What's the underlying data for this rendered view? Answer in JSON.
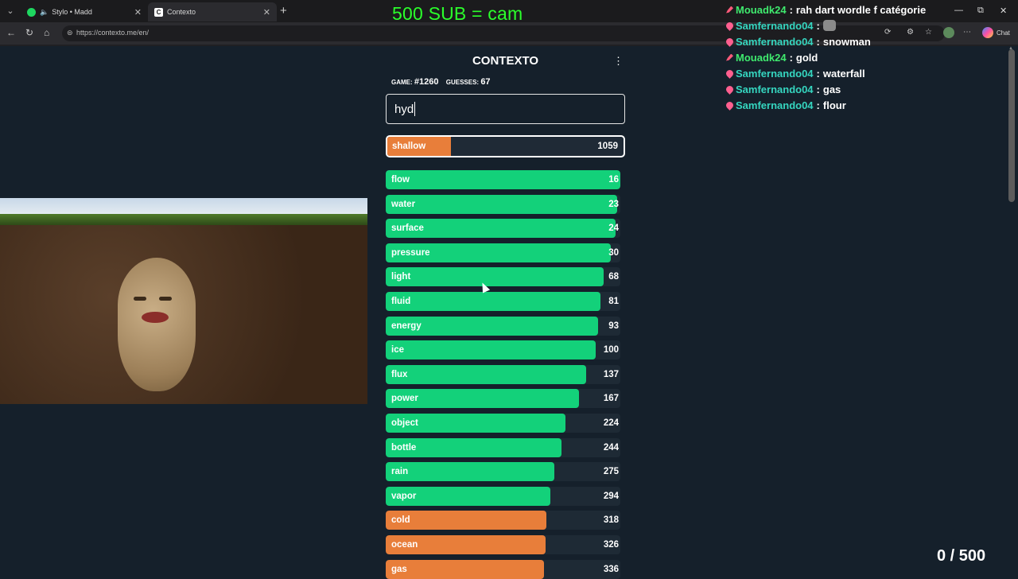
{
  "browser": {
    "tabs": [
      {
        "label": "Stylo • Madd",
        "favicon": "spotify-icon"
      },
      {
        "label": "Contexto",
        "favicon": "contexto-favicon"
      }
    ],
    "favicon_letter": "C",
    "url": "https://contexto.me/en/",
    "chat_button": "Chat"
  },
  "overlay": {
    "title": "500 SUB = cam",
    "sub_counter": "0 / 500"
  },
  "chat": [
    {
      "badge": "pencil",
      "user": "Mouadk24",
      "user_color": "#3fea6e",
      "message": "rah dart wordle f catégorie"
    },
    {
      "badge": "heart",
      "user": "Samfernando04",
      "user_color": "#35d6c0",
      "message": "",
      "emote": "cat-emote"
    },
    {
      "badge": "heart",
      "user": "Samfernando04",
      "user_color": "#35d6c0",
      "message": "snowman"
    },
    {
      "badge": "pencil",
      "user": "Mouadk24",
      "user_color": "#3fea6e",
      "message": "gold"
    },
    {
      "badge": "heart",
      "user": "Samfernando04",
      "user_color": "#35d6c0",
      "message": "waterfall"
    },
    {
      "badge": "heart",
      "user": "Samfernando04",
      "user_color": "#35d6c0",
      "message": "gas"
    },
    {
      "badge": "heart",
      "user": "Samfernando04",
      "user_color": "#35d6c0",
      "message": "flour"
    }
  ],
  "game": {
    "title": "CONTEXTO",
    "game_label": "Game:",
    "game_number": "#1260",
    "guesses_label": "Guesses:",
    "guesses_count": "67",
    "input_value": "hyd",
    "last_guess": {
      "word": "shallow",
      "rank": 1059,
      "fill": 0.27,
      "color": "#e87e3a"
    },
    "colors": {
      "green": "#13d17a",
      "orange": "#e87e3a",
      "red": "#f02d5a"
    },
    "guesses": [
      {
        "word": "flow",
        "rank": 16,
        "fill": 1.0,
        "color": "green"
      },
      {
        "word": "water",
        "rank": 23,
        "fill": 0.985,
        "color": "green"
      },
      {
        "word": "surface",
        "rank": 24,
        "fill": 0.98,
        "color": "green"
      },
      {
        "word": "pressure",
        "rank": 30,
        "fill": 0.96,
        "color": "green"
      },
      {
        "word": "light",
        "rank": 68,
        "fill": 0.93,
        "color": "green"
      },
      {
        "word": "fluid",
        "rank": 81,
        "fill": 0.915,
        "color": "green"
      },
      {
        "word": "energy",
        "rank": 93,
        "fill": 0.905,
        "color": "green"
      },
      {
        "word": "ice",
        "rank": 100,
        "fill": 0.895,
        "color": "green"
      },
      {
        "word": "flux",
        "rank": 137,
        "fill": 0.855,
        "color": "green"
      },
      {
        "word": "power",
        "rank": 167,
        "fill": 0.825,
        "color": "green"
      },
      {
        "word": "object",
        "rank": 224,
        "fill": 0.765,
        "color": "green"
      },
      {
        "word": "bottle",
        "rank": 244,
        "fill": 0.75,
        "color": "green"
      },
      {
        "word": "rain",
        "rank": 275,
        "fill": 0.72,
        "color": "green"
      },
      {
        "word": "vapor",
        "rank": 294,
        "fill": 0.7,
        "color": "green"
      },
      {
        "word": "cold",
        "rank": 318,
        "fill": 0.685,
        "color": "orange"
      },
      {
        "word": "ocean",
        "rank": 326,
        "fill": 0.68,
        "color": "orange"
      },
      {
        "word": "gas",
        "rank": 336,
        "fill": 0.675,
        "color": "orange"
      }
    ]
  }
}
